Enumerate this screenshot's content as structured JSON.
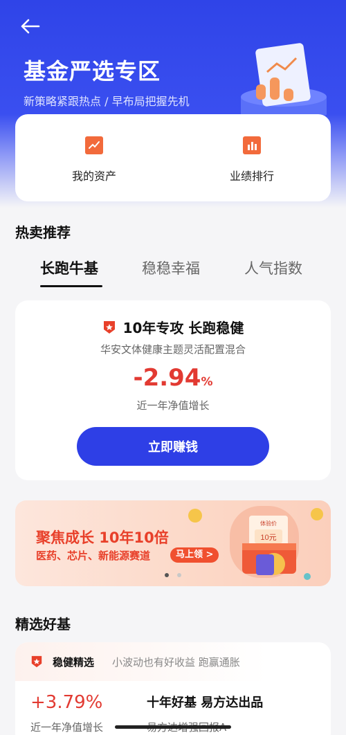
{
  "header": {
    "title": "基金严选专区",
    "subtitle": "新策略紧跟热点 / 早布局把握先机",
    "back_icon": "arrow-left-icon"
  },
  "quick_actions": [
    {
      "label": "我的资产",
      "icon": "line-chart-icon"
    },
    {
      "label": "业绩排行",
      "icon": "bar-chart-icon"
    }
  ],
  "hot": {
    "title": "热卖推荐",
    "tabs": [
      "长跑牛基",
      "稳稳幸福",
      "人气指数"
    ],
    "active_tab": 0,
    "card": {
      "tagline": "10年专攻 长跑稳健",
      "fund_name": "华安文体健康主题灵活配置混合",
      "return_value": "-2.94",
      "return_unit": "%",
      "return_label": "近一年净值增长",
      "cta_label": "立即赚钱"
    }
  },
  "banner": {
    "title": "聚焦成长 10年10倍",
    "subtitle": "医药、芯片、新能源赛道",
    "pill": "马上领 >",
    "ticket_top": "体验价",
    "ticket_amount": "10元",
    "dots_total": 2,
    "dots_active": 0
  },
  "picks": {
    "title": "精选好基",
    "tag": "稳健精选",
    "desc": "小波动也有好收益 跑赢通胀",
    "return_value": "+3.79%",
    "return_label": "近一年净值增长",
    "headline": "十年好基 易方达出品",
    "fund_name": "易方达增强回报A"
  },
  "colors": {
    "brand_blue": "#2e3fe6",
    "accent_red": "#e23a32",
    "icon_orange": "#f26a3b"
  }
}
